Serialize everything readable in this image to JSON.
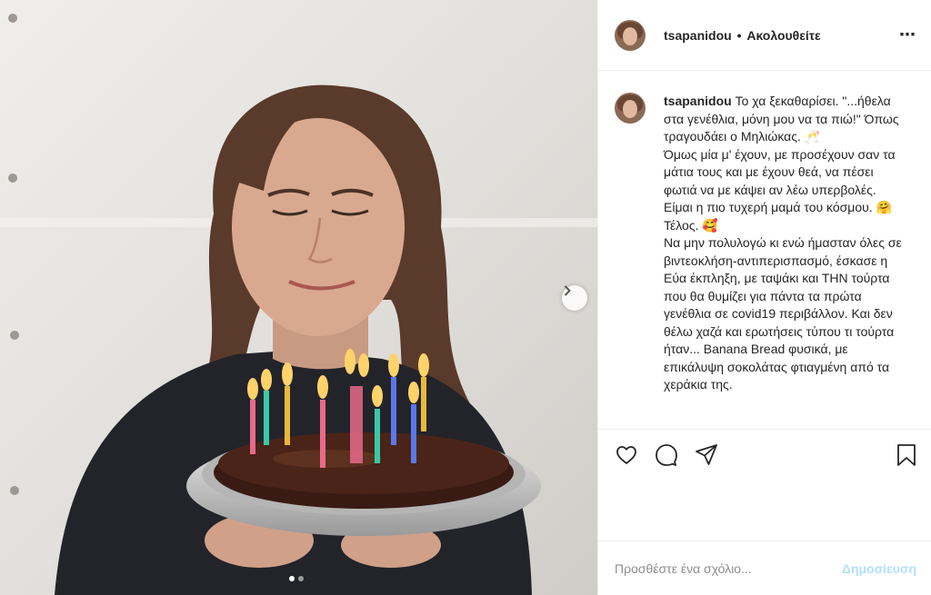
{
  "post": {
    "username": "tsapanidou",
    "follow_label": "Ακολουθείτε",
    "separator": "•",
    "more_icon": "⋯",
    "caption_text": "Το χα ξεκαθαρίσει. \"...ήθελα στα γενέθλια, μόνη μου να τα πιώ!\" Όπως τραγουδάει ο Μηλιώκας. 🥂\nΌμως μία μ' έχουν, με προσέχουν σαν τα μάτια τους και με έχουν θεά, να πέσει φωτιά να με κάψει αν λέω υπερβολές. Είμαι η πιο τυχερή μαμά του κόσμου. 🤗 Τέλος. 🥰\nΝα μην πολυλογώ κι ενώ ήμασταν όλες σε βιντεοκλήση-αντιπερισπασμό, έσκασε η Εύα έκπληξη, με ταψάκι και ΤΗΝ τούρτα που θα θυμίζει για πάντα τα πρώτα γενέθλια σε covid19 περιβάλλον. Και δεν θέλω χαζά και ερωτήσεις τύπου τι τούρτα ήταν... Banana Bread φυσικά, με επικάλυψη σοκολάτας φτιαγμένη από τα χεράκια της."
  },
  "comment_box": {
    "placeholder": "Προσθέστε ένα σχόλιο...",
    "post_label": "Δημοσίευση"
  },
  "carousel": {
    "slide_count": 2,
    "active_index": 0
  },
  "icons": {
    "like": "heart-icon",
    "comment": "comment-bubble-icon",
    "share": "paper-plane-icon",
    "save": "bookmark-icon",
    "next": "chevron-right-icon",
    "more": "more-options-icon"
  },
  "colors": {
    "accent_link": "#b2dffc",
    "text": "#262626",
    "muted": "#8e8e8e",
    "divider": "#efefef"
  }
}
